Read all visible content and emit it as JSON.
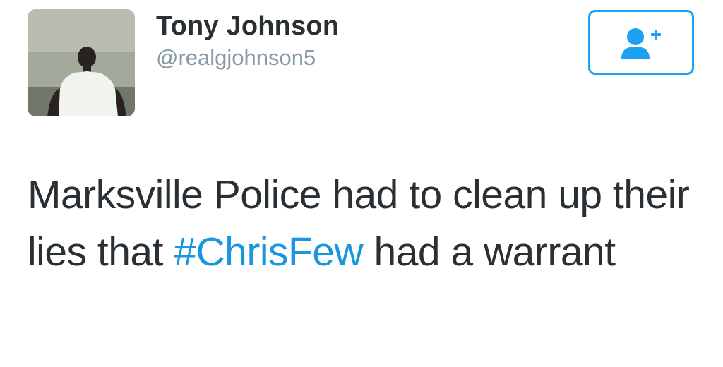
{
  "user": {
    "display_name": "Tony Johnson",
    "handle": "@realgjohnson5",
    "avatar_icon": "profile-photo"
  },
  "follow_button": {
    "icon": "add-user-icon",
    "color": "#1da1f2"
  },
  "tweet": {
    "text_before": "Marksville Police had to clean up their lies that ",
    "hashtag": "#ChrisFew",
    "text_after": " had a warrant",
    "hashtag_color": "#1b95e0"
  }
}
